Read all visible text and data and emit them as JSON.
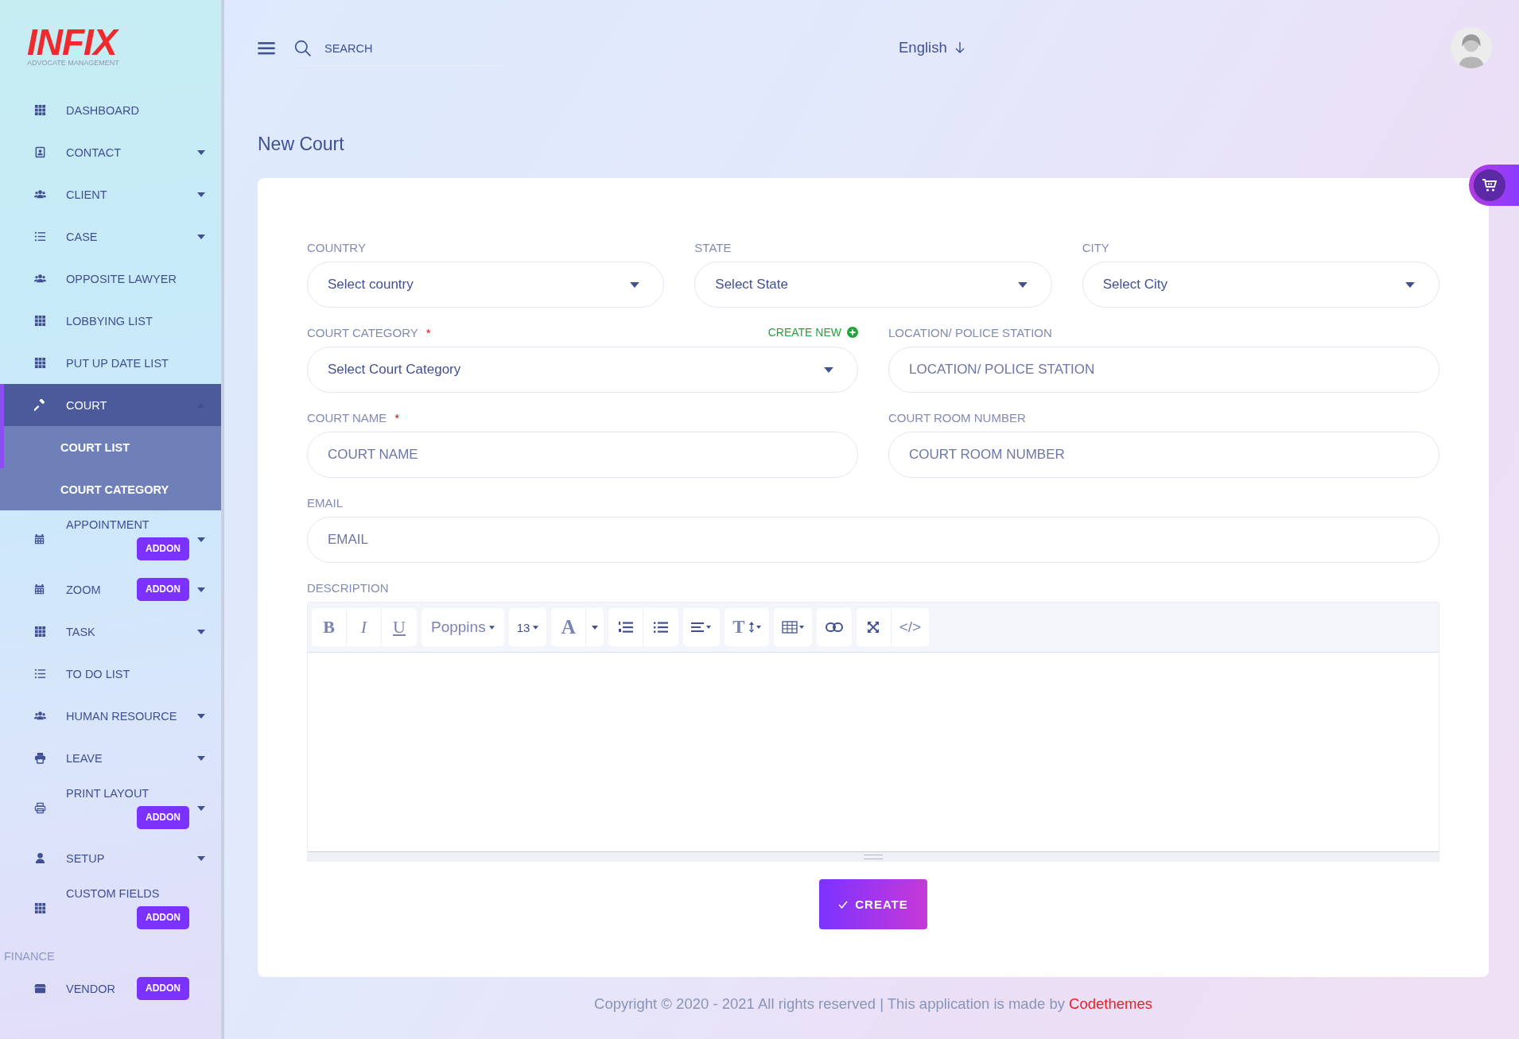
{
  "sidebar": {
    "logo": {
      "text": "INFIX",
      "subtitle": "ADVOCATE MANAGEMENT"
    },
    "items": [
      {
        "kind": "item",
        "label": "DASHBOARD",
        "selected": false
      },
      {
        "kind": "item",
        "label": "CONTACT",
        "expandable": true,
        "expanded": false,
        "selected": false
      },
      {
        "kind": "item",
        "label": "CLIENT",
        "expandable": true,
        "expanded": false,
        "selected": false
      },
      {
        "kind": "item",
        "label": "CASE",
        "expandable": true,
        "expanded": false,
        "selected": false
      },
      {
        "kind": "item",
        "label": "OPPOSITE LAWYER",
        "selected": false
      },
      {
        "kind": "item",
        "label": "LOBBYING LIST",
        "selected": false
      },
      {
        "kind": "item",
        "label": "PUT UP DATE LIST",
        "selected": false
      },
      {
        "kind": "item",
        "label": "COURT",
        "expandable": true,
        "expanded": true,
        "selected": true,
        "children": [
          {
            "label": "COURT LIST",
            "selected": true
          },
          {
            "label": "COURT CATEGORY",
            "selected": false
          }
        ]
      },
      {
        "kind": "item",
        "label": "APPOINTMENT",
        "expandable": true,
        "expanded": false,
        "selected": false,
        "badge": "ADDON"
      },
      {
        "kind": "item",
        "label": "ZOOM",
        "expandable": true,
        "expanded": false,
        "selected": false,
        "badge": "ADDON"
      },
      {
        "kind": "item",
        "label": "TASK",
        "expandable": true,
        "expanded": false,
        "selected": false
      },
      {
        "kind": "item",
        "label": "TO DO LIST",
        "selected": false
      },
      {
        "kind": "item",
        "label": "HUMAN RESOURCE",
        "expandable": true,
        "expanded": false,
        "selected": false
      },
      {
        "kind": "item",
        "label": "LEAVE",
        "expandable": true,
        "expanded": false,
        "selected": false
      },
      {
        "kind": "item",
        "label": "PRINT LAYOUT",
        "expandable": true,
        "expanded": false,
        "selected": false,
        "badge": "ADDON"
      },
      {
        "kind": "item",
        "label": "SETUP",
        "expandable": true,
        "expanded": false,
        "selected": false
      },
      {
        "kind": "item",
        "label": "CUSTOM FIELDS",
        "selected": false,
        "badge": "ADDON"
      },
      {
        "kind": "section",
        "label": "FINANCE"
      },
      {
        "kind": "item",
        "label": "VENDOR",
        "selected": false,
        "badge": "ADDON"
      }
    ]
  },
  "header": {
    "search": {
      "placeholder": "SEARCH"
    },
    "language": "English"
  },
  "page_title": "New Court",
  "form": {
    "rows": [
      [
        {
          "kind": "select",
          "label": "COUNTRY",
          "value": "Select country"
        },
        {
          "kind": "select",
          "label": "STATE",
          "value": "Select State"
        },
        {
          "kind": "select",
          "label": "CITY",
          "value": "Select City"
        }
      ],
      [
        {
          "kind": "select",
          "label": "COURT CATEGORY",
          "required_mark": "*",
          "action": "CREATE NEW",
          "value": "Select Court Category"
        },
        {
          "kind": "input",
          "label": "LOCATION/ POLICE STATION",
          "placeholder": "LOCATION/ POLICE STATION"
        }
      ],
      [
        {
          "kind": "input",
          "label": "COURT NAME",
          "required_mark": "*",
          "placeholder": "COURT NAME"
        },
        {
          "kind": "input",
          "label": "COURT ROOM NUMBER",
          "placeholder": "COURT ROOM NUMBER"
        }
      ],
      [
        {
          "kind": "input",
          "label": "EMAIL",
          "placeholder": "EMAIL"
        }
      ]
    ],
    "description": {
      "label": "DESCRIPTION",
      "toolbar": [
        [
          {
            "kind": "bold",
            "text": "B"
          },
          {
            "kind": "italic",
            "text": "I"
          },
          {
            "kind": "underline",
            "text": "U"
          }
        ],
        [
          {
            "kind": "font",
            "text": "Poppins"
          }
        ],
        [
          {
            "kind": "size",
            "text": "13"
          }
        ],
        [
          {
            "kind": "color",
            "text": "A"
          },
          {
            "kind": "dropdown"
          }
        ],
        [
          {
            "kind": "ordered-list"
          },
          {
            "kind": "unordered-list"
          }
        ],
        [
          {
            "kind": "align"
          }
        ],
        [
          {
            "kind": "line-height",
            "text": "T"
          }
        ],
        [
          {
            "kind": "table"
          }
        ],
        [
          {
            "kind": "link"
          }
        ],
        [
          {
            "kind": "fullscreen"
          },
          {
            "kind": "code",
            "text": "</>"
          }
        ]
      ]
    },
    "submit": "CREATE"
  },
  "footer": {
    "text": "Copyright © 2020 - 2021 All rights reserved | This application is made by",
    "link": "Codethemes"
  }
}
